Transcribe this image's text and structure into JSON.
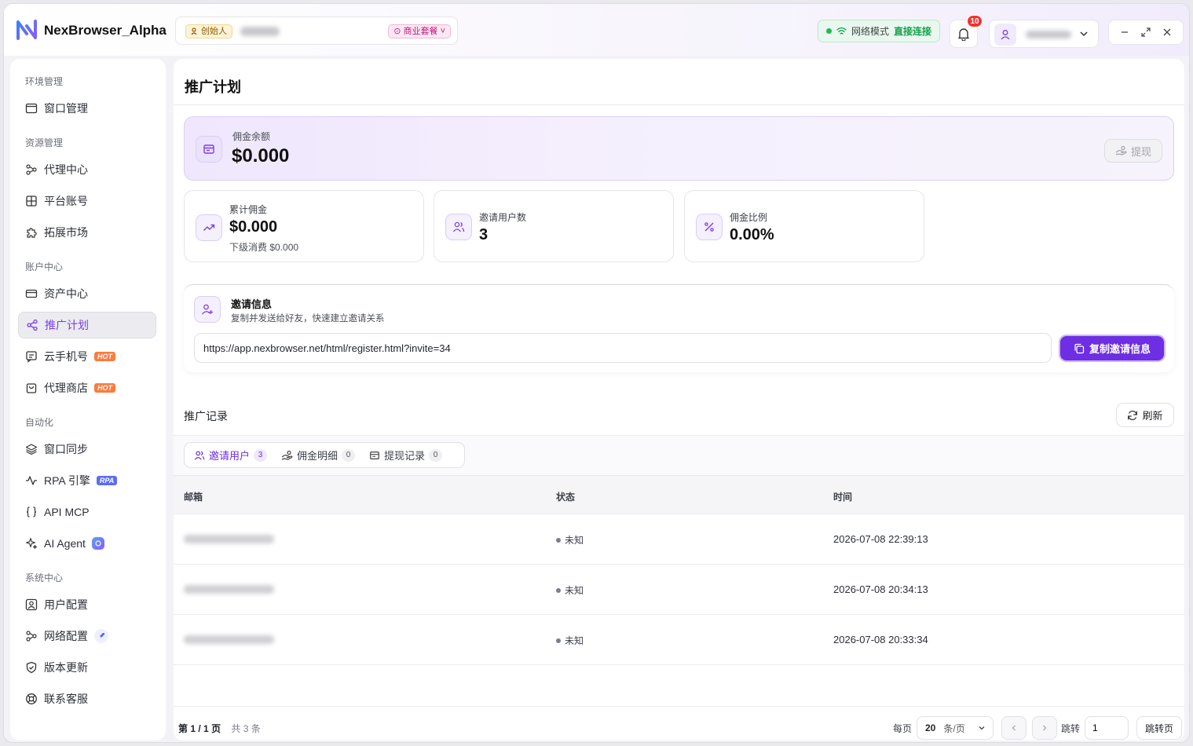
{
  "app": {
    "brand": "NexBrowser_Alpha"
  },
  "account": {
    "founder_label": "创始人",
    "plan_label": "商业套餐"
  },
  "network": {
    "mode_label": "网络模式",
    "mode_value": "直接连接"
  },
  "notifications": {
    "count": "10"
  },
  "sidebar": {
    "sections": [
      {
        "title": "环境管理"
      },
      {
        "title": "资源管理"
      },
      {
        "title": "账户中心"
      },
      {
        "title": "自动化"
      },
      {
        "title": "系统中心"
      }
    ],
    "items": [
      {
        "label": "窗口管理"
      },
      {
        "label": "代理中心"
      },
      {
        "label": "平台账号"
      },
      {
        "label": "拓展市场"
      },
      {
        "label": "资产中心"
      },
      {
        "label": "推广计划"
      },
      {
        "label": "云手机号",
        "badge": "HOT"
      },
      {
        "label": "代理商店",
        "badge": "HOT"
      },
      {
        "label": "窗口同步"
      },
      {
        "label": "RPA 引擎",
        "badge": "RPA"
      },
      {
        "label": "API MCP"
      },
      {
        "label": "AI Agent"
      },
      {
        "label": "用户配置"
      },
      {
        "label": "网络配置"
      },
      {
        "label": "版本更新"
      },
      {
        "label": "联系客服"
      }
    ]
  },
  "main": {
    "title": "推广计划",
    "balance": {
      "label": "佣金余额",
      "value": "$0.000",
      "withdraw_label": "提现"
    },
    "stats": [
      {
        "label": "累计佣金",
        "value": "$0.000",
        "sub": "下级消费 $0.000"
      },
      {
        "label": "邀请用户数",
        "value": "3"
      },
      {
        "label": "佣金比例",
        "value": "0.00%"
      }
    ],
    "invite": {
      "title": "邀请信息",
      "desc": "复制并发送给好友，快速建立邀请关系",
      "url": "https://app.nexbrowser.net/html/register.html?invite=34",
      "copy_label": "复制邀请信息"
    },
    "records": {
      "title": "推广记录",
      "refresh_label": "刷新",
      "tabs": [
        {
          "label": "邀请用户",
          "count": "3"
        },
        {
          "label": "佣金明细",
          "count": "0"
        },
        {
          "label": "提现记录",
          "count": "0"
        }
      ],
      "columns": [
        "邮箱",
        "状态",
        "时间"
      ],
      "rows": [
        {
          "status": "未知",
          "time": "2026-07-08 22:39:13"
        },
        {
          "status": "未知",
          "time": "2026-07-08 20:34:13"
        },
        {
          "status": "未知",
          "time": "2026-07-08 20:33:34"
        }
      ]
    },
    "pager": {
      "page_prefix": "第",
      "page_value": "1 / 1",
      "page_suffix": "页",
      "total": "共 3 条",
      "per_page_label": "每页",
      "page_size": "20",
      "page_size_unit": "条/页",
      "jump_label": "跳转",
      "jump_value": "1",
      "jump_button": "跳转页"
    }
  }
}
